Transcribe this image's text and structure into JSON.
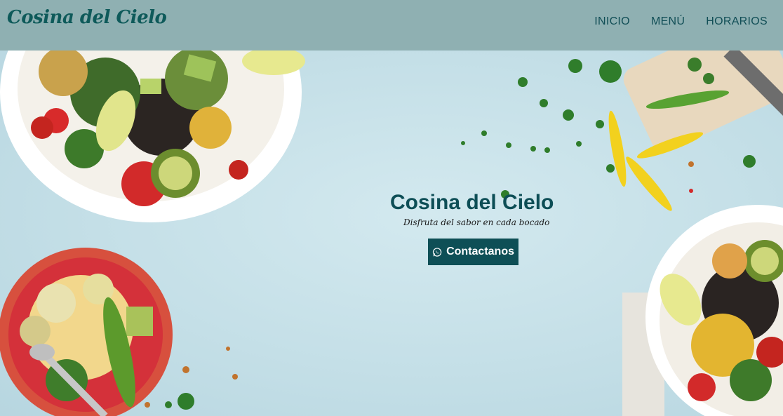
{
  "header": {
    "brand": "Cosina del Cielo",
    "nav": [
      {
        "label": "INICIO"
      },
      {
        "label": "MENÚ"
      },
      {
        "label": "HORARIOS"
      }
    ]
  },
  "hero": {
    "title": "Cosina del Cielo",
    "subtitle": "Disfruta del sabor en cada bocado",
    "cta_label": "Contactanos",
    "cta_icon": "whatsapp-icon"
  },
  "colors": {
    "navbar_bg": "#8fb0b2",
    "brand_text": "#0e5a5a",
    "hero_bg": "#c9e2ea",
    "cta_bg": "#0e4f56"
  }
}
